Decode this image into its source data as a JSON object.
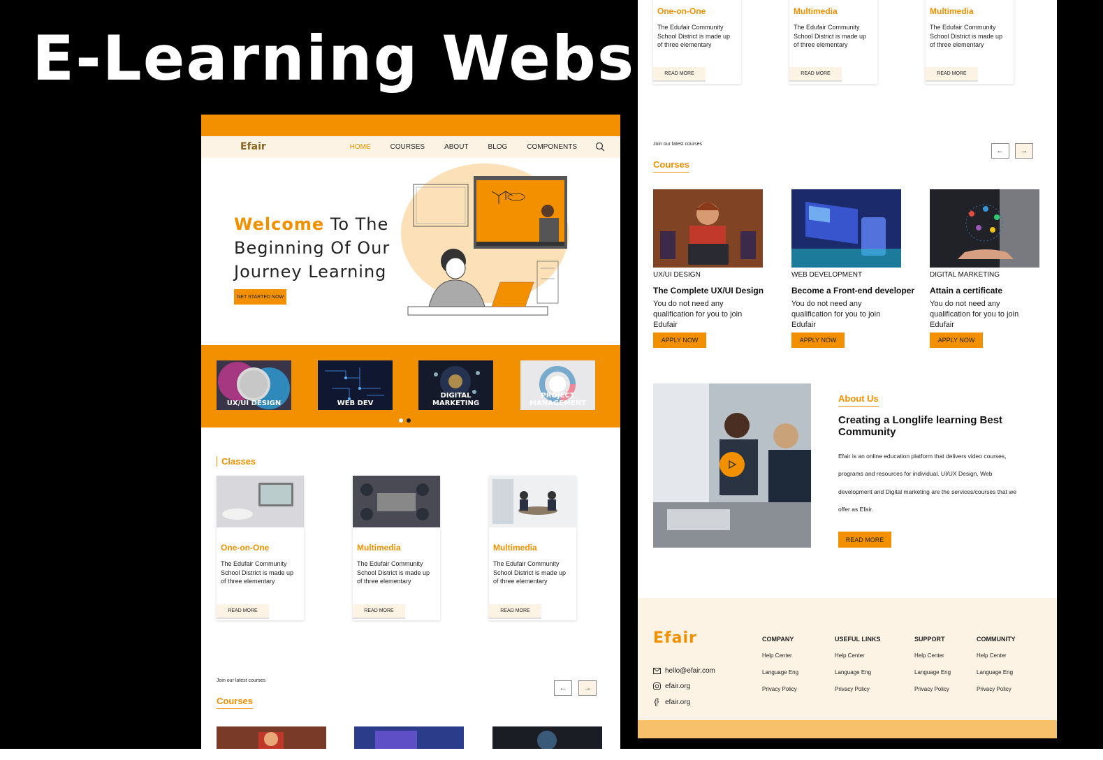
{
  "title": "E-Learning Website",
  "nav": {
    "logo": "Efair",
    "links": [
      "HOME",
      "COURSES",
      "ABOUT",
      "BLOG",
      "COMPONENTS"
    ]
  },
  "hero": {
    "accent": "Welcome",
    "line1_rest": " To The",
    "line2": "Beginning Of Our",
    "line3": "Journey Learning",
    "cta": "GET STARTED NOW"
  },
  "categories": [
    "UX/UI DESIGN",
    "WEB DEV",
    "DIGITAL MARKETING",
    "PROJECT MANAGEMENT"
  ],
  "classes": {
    "title": "Classes",
    "items": [
      {
        "name": "One-on-One",
        "desc": "The Edufair Community School District is made up of three elementary",
        "button": "READ MORE"
      },
      {
        "name": "Multimedia",
        "desc": "The Edufair Community School District is made up of three elementary",
        "button": "READ MORE"
      },
      {
        "name": "Multimedia",
        "desc": "The Edufair Community School District is made up of three elementary",
        "button": "READ MORE"
      }
    ]
  },
  "courses": {
    "join": "Join our latest courses",
    "title": "Courses",
    "items": [
      {
        "category": "UX/UI DESIGN",
        "title": "The Complete UX/UI Design",
        "desc": "You do not need any qualification for you to join Edufair",
        "button": "APPLY NOW"
      },
      {
        "category": "WEB DEVELOPMENT",
        "title": "Become a Front-end developer",
        "desc": "You do not need any qualification for you to join Edufair",
        "button": "APPLY NOW"
      },
      {
        "category": "DIGITAL MARKETING",
        "title": "Attain a certificate",
        "desc": "You do not need any qualification for you to join Edufair",
        "button": "APPLY NOW"
      }
    ]
  },
  "about": {
    "heading": "About Us",
    "title": "Creating a Longlife learning Best Community",
    "text": "Efair is an online education platform that delivers video courses, programs and resources for individual. UI/UX Design, Web development and Digital marketing are the services/courses that we offer as Efair.",
    "button": "READ MORE"
  },
  "footer": {
    "logo": "Efair",
    "email": "hello@efair.com",
    "instagram": "efair.org",
    "facebook": "efair.org",
    "columns": [
      {
        "title": "COMPANY",
        "links": [
          "Help Center",
          "Language Eng",
          "Privacy Policy"
        ]
      },
      {
        "title": "USEFUL LINKS",
        "links": [
          "Help Center",
          "Language Eng",
          "Privacy Policy"
        ]
      },
      {
        "title": "SUPPORT",
        "links": [
          "Help Center",
          "Language Eng",
          "Privacy Policy"
        ]
      },
      {
        "title": "COMMUNITY",
        "links": [
          "Help Center",
          "Language Eng",
          "Privacy Policy"
        ]
      }
    ]
  },
  "colors": {
    "accent": "#f29000",
    "cream": "#fdf3e5",
    "footer_strip": "#f7c06a"
  }
}
